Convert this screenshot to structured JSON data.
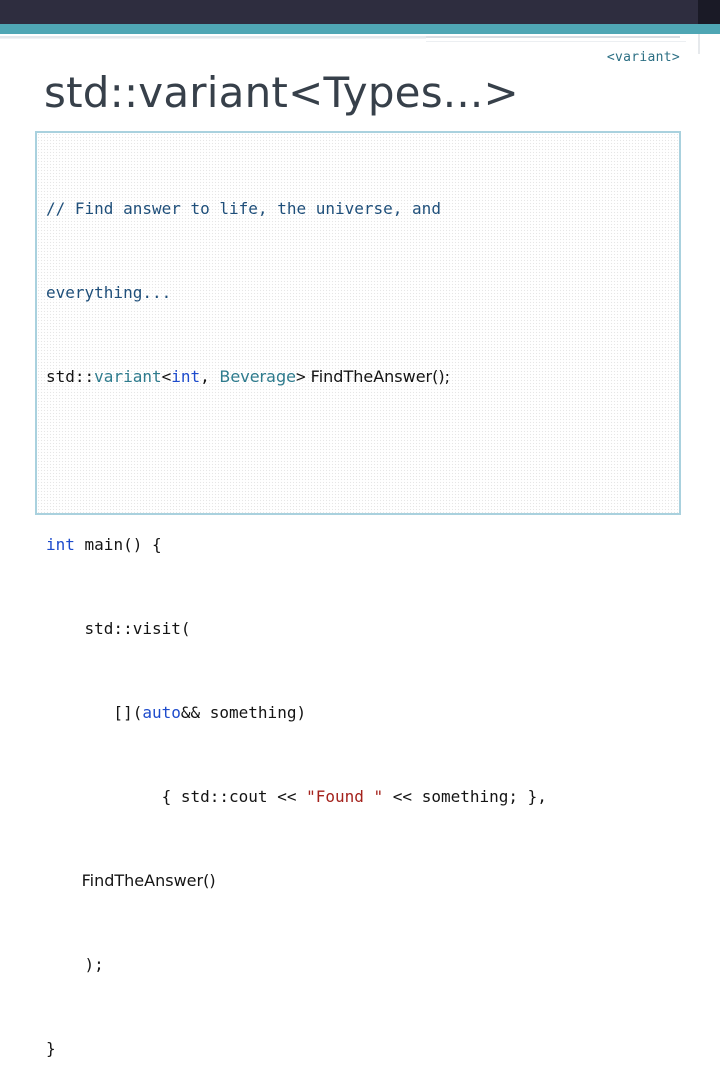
{
  "corner_tag": "<variant>",
  "title": "std::variant<Types...>",
  "code": {
    "l1": "// Find answer to life, the universe, and",
    "l2": "everything...",
    "l3_ns": "std::",
    "l3_variant": "variant",
    "l3_lt": "<",
    "l3_int": "int",
    "l3_comma": ", ",
    "l3_beverage": "Beverage",
    "l3_gt": ">",
    "l3_rest": " FindTheAnswer();",
    "l5_int": "int",
    "l5_rest": " main() {",
    "l6": "    std::visit(",
    "l7_pre": "       [](",
    "l7_auto": "auto",
    "l7_rest": "&& something)",
    "l8_pre": "            { std::cout << ",
    "l8_str": "\"Found \"",
    "l8_rest": " << something; },",
    "l9": "       FindTheAnswer()",
    "l10": "    );",
    "l11": "}"
  }
}
